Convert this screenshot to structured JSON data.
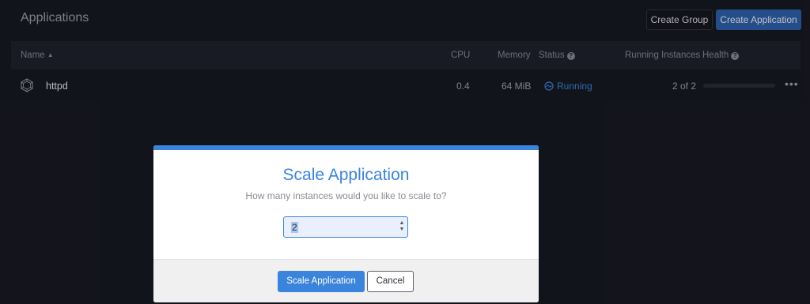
{
  "header": {
    "title": "Applications",
    "create_group_label": "Create Group",
    "create_application_label": "Create Application"
  },
  "table": {
    "columns": {
      "name": "Name",
      "cpu": "CPU",
      "memory": "Memory",
      "status": "Status",
      "running_instances": "Running Instances",
      "health": "Health"
    },
    "rows": [
      {
        "name": "httpd",
        "cpu": "0.4",
        "memory": "64 MiB",
        "status": "Running",
        "running_instances": "2 of 2",
        "health_fraction": 0
      }
    ]
  },
  "modal": {
    "title": "Scale Application",
    "subtitle": "How many instances would you like to scale to?",
    "input_value": "2",
    "primary_label": "Scale Application",
    "cancel_label": "Cancel"
  },
  "icons": {
    "sort": "sort-ascending-icon",
    "help": "help-circle-icon",
    "app": "app-icon",
    "status": "status-running-icon",
    "more": "more-options-icon"
  },
  "colors": {
    "accent": "#3a84dc",
    "background": "#171922",
    "primary_button": "#2d5fa8",
    "status_running": "#3b82d6"
  }
}
